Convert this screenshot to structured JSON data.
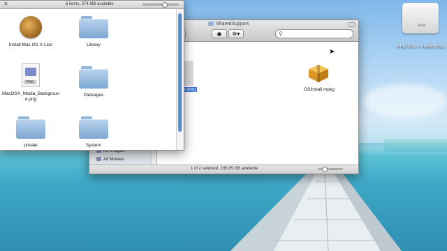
{
  "desktop": {
    "drive_label": "Mac OS X Install ESD"
  },
  "front_window": {
    "status": "6 items, 374 MB available",
    "items": [
      {
        "label": "Install Mac OS X Lion",
        "icon": "lion-installer-icon"
      },
      {
        "label": "Library",
        "icon": "folder-icon"
      },
      {
        "label": "MacOSX_Media_Background.png",
        "label_line1": "MacOSX_Media_Backgroun",
        "label_line2": "d.png",
        "icon": "png-file-icon",
        "tag": "PNG"
      },
      {
        "label": "Packages",
        "icon": "folder-icon"
      },
      {
        "label": "private",
        "icon": "folder-icon"
      },
      {
        "label": "System",
        "icon": "folder-icon"
      }
    ]
  },
  "back_window": {
    "title": "SharedSupport",
    "search_placeholder": "",
    "files": [
      {
        "label": "...D.dmg",
        "shown": "D.dmg",
        "selected": true
      },
      {
        "label": "OSInstall.mpkg",
        "selected": false
      }
    ],
    "sidebar": [
      {
        "label": "All Images"
      },
      {
        "label": "All Movies"
      }
    ],
    "status": "1 of 2 selected, 235.85 GB available"
  },
  "colors": {
    "selection": "#3875d7",
    "folder": "#8fb6dc",
    "scroll_thumb": "#3d7ad1"
  }
}
